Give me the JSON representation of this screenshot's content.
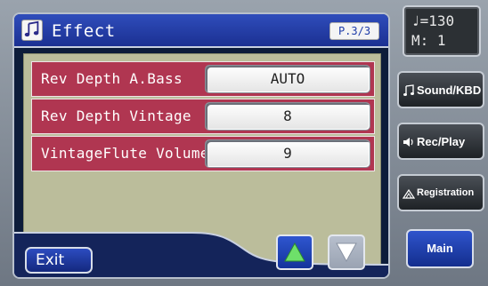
{
  "title": "Effect",
  "page_indicator": "P.3/3",
  "params": [
    {
      "label": "Rev Depth A.Bass",
      "value": "AUTO"
    },
    {
      "label": "Rev Depth Vintage",
      "value": "8"
    },
    {
      "label": "VintageFlute Volume",
      "value": "9"
    }
  ],
  "exit_label": "Exit",
  "tempo": {
    "line1": "♩=130",
    "line2": "M:  1"
  },
  "side_buttons": {
    "sound_kbd": "Sound/KBD",
    "rec_play": "Rec/Play",
    "registration": "Registration",
    "main": "Main"
  },
  "colors": {
    "panel": "#0d1c3a",
    "title_bar": "#2440a8",
    "content_bg": "#bbbd9b",
    "row_bg": "#b03651",
    "arrow_active": "#2f56d0",
    "arrow_disabled": "#b7bfcd"
  },
  "icons": {
    "title": "music-notes-icon",
    "sound_kbd": "music-note-icon",
    "rec_play": "speaker-icon",
    "registration": "registration-icon",
    "up": "triangle-up-icon",
    "down": "triangle-down-icon"
  }
}
